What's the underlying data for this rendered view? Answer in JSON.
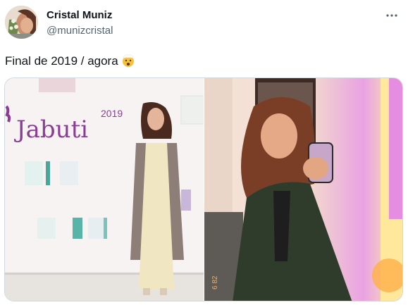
{
  "author": {
    "name": "Cristal Muniz",
    "handle": "@munizcristal"
  },
  "tweet": {
    "text": "Final de 2019 / agora",
    "emoji": "exploding-head-emoji"
  },
  "media": {
    "left_photo": {
      "banner_brand": "Jabuti",
      "banner_year": "2019"
    },
    "right_photo": {
      "timestamp_fragment": "6 82"
    }
  },
  "icons": {
    "more": "more-dots-icon"
  }
}
